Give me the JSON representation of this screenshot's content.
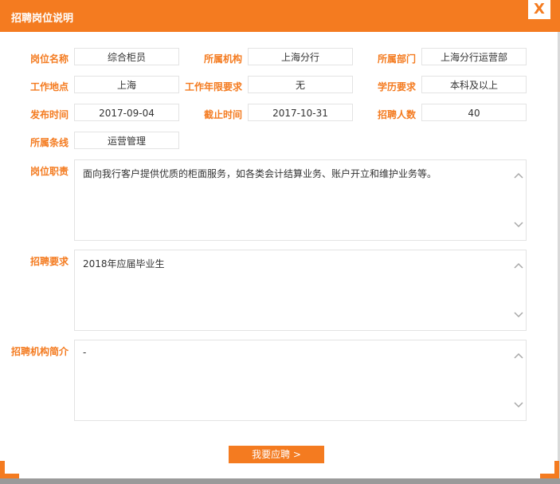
{
  "dialog": {
    "title": "招聘岗位说明",
    "close_label": "X"
  },
  "fields": {
    "position_name": {
      "label": "岗位名称",
      "value": "综合柜员"
    },
    "institution": {
      "label": "所属机构",
      "value": "上海分行"
    },
    "department": {
      "label": "所属部门",
      "value": "上海分行运营部"
    },
    "location": {
      "label": "工作地点",
      "value": "上海"
    },
    "experience": {
      "label": "工作年限要求",
      "value": "无"
    },
    "education": {
      "label": "学历要求",
      "value": "本科及以上"
    },
    "publish_date": {
      "label": "发布时间",
      "value": "2017-09-04"
    },
    "deadline": {
      "label": "截止时间",
      "value": "2017-10-31"
    },
    "headcount": {
      "label": "招聘人数",
      "value": "40"
    },
    "business_line": {
      "label": "所属条线",
      "value": "运营管理"
    }
  },
  "textareas": {
    "duties": {
      "label": "岗位职责",
      "value": "面向我行客户提供优质的柜面服务，如各类会计结算业务、账户开立和维护业务等。"
    },
    "requirements": {
      "label": "招聘要求",
      "value": "2018年应届毕业生"
    },
    "org_intro": {
      "label": "招聘机构简介",
      "value": "-"
    }
  },
  "actions": {
    "apply_label": "我要应聘 >"
  },
  "icons": {
    "scroll_up": "chevron-up-icon",
    "scroll_down": "chevron-down-icon"
  },
  "colors": {
    "accent": "#f47b20",
    "border": "#e3e3e3"
  }
}
